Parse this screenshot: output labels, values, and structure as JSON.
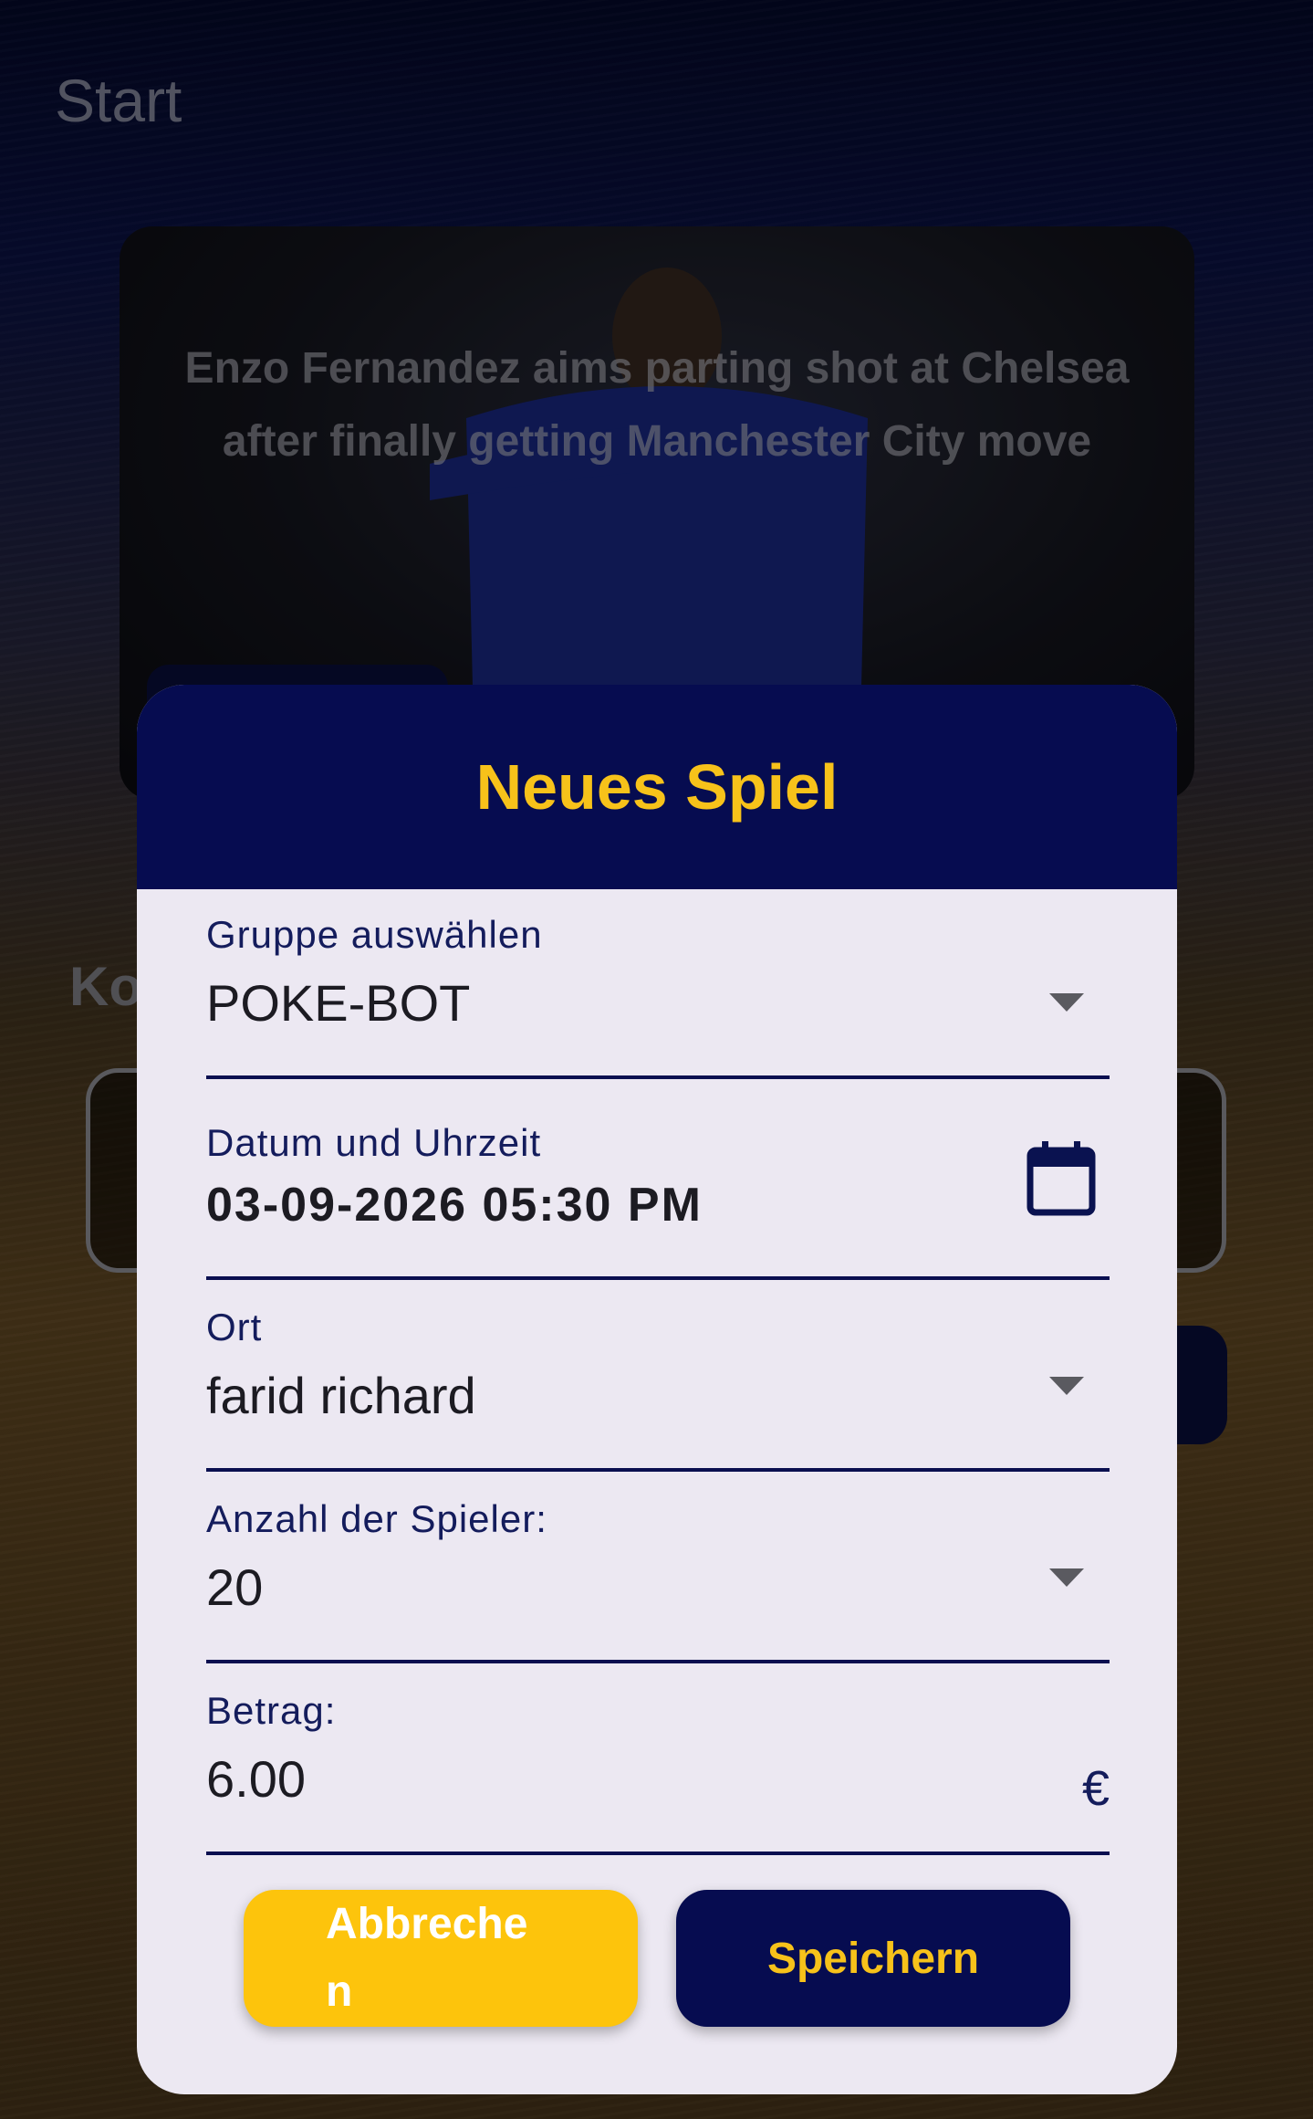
{
  "page": {
    "title": "Start"
  },
  "news": {
    "headline": "Enzo Fernandez aims parting shot at Chelsea after finally getting Manchester City move"
  },
  "background": {
    "section_label": "Ko"
  },
  "dialog": {
    "title": "Neues Spiel",
    "group": {
      "label": "Gruppe auswählen",
      "value": "POKE-BOT",
      "icon": "chevron-down-icon"
    },
    "datetime": {
      "label": "Datum und Uhrzeit",
      "value": "03-09-2026 05:30 PM",
      "icon": "calendar-icon"
    },
    "location": {
      "label": "Ort",
      "value": "farid richard",
      "icon": "chevron-down-icon"
    },
    "players": {
      "label": "Anzahl der Spieler:",
      "value": "20",
      "icon": "chevron-down-icon"
    },
    "amount": {
      "label": "Betrag:",
      "value": "6.00",
      "currency": "€"
    },
    "cancel_label": "Abbrechen",
    "save_label": "Speichern"
  },
  "colors": {
    "primary": "#060c50",
    "accent": "#f7c21a",
    "dialog_bg": "#ece8f2"
  }
}
